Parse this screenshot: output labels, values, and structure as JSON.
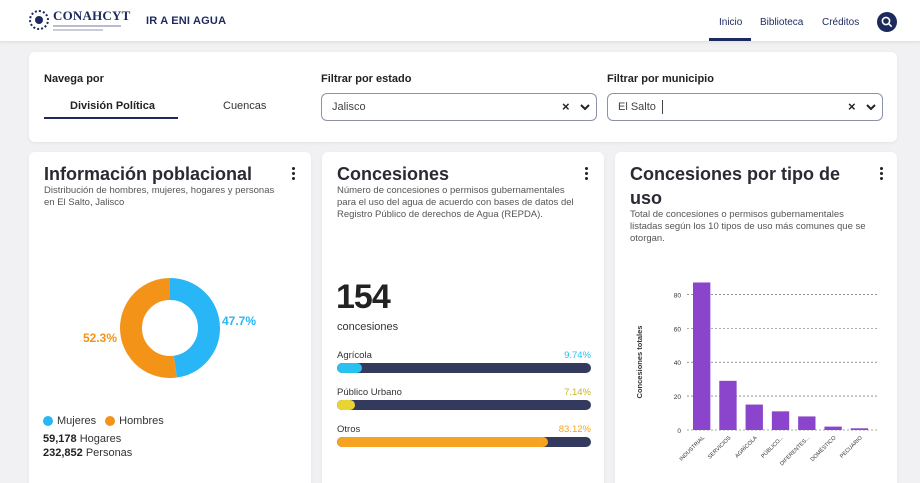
{
  "header": {
    "logo_text": "CONAHCYT",
    "ir_link": "IR A ENI AGUA",
    "nav": [
      {
        "label": "Inicio",
        "active": true
      },
      {
        "label": "Biblioteca",
        "active": false
      },
      {
        "label": "Créditos",
        "active": false
      }
    ],
    "search_icon": "search-icon"
  },
  "filters": {
    "navega_label": "Navega por",
    "tabs": [
      {
        "label": "División Política",
        "active": true
      },
      {
        "label": "Cuencas",
        "active": false
      }
    ],
    "estado_label": "Filtrar por estado",
    "estado_value": "Jalisco",
    "municipio_label": "Filtrar por municipio",
    "municipio_value": "El Salto"
  },
  "poblacion": {
    "title": "Información poblacional",
    "desc_lines": [
      "Distribución de hombres, mujeres, hogares y personas",
      "en El Salto, Jalisco"
    ],
    "donut": {
      "mujeres_pct": 47.7,
      "hombres_pct": 52.3,
      "mujeres_label": "47.7%",
      "hombres_label": "52.3%"
    },
    "legend": {
      "mujeres": "Mujeres",
      "hombres": "Hombres"
    },
    "hogares_value": "59,178",
    "hogares_label": "Hogares",
    "personas_value": "232,852",
    "personas_label": "Personas"
  },
  "concesiones": {
    "title": "Concesiones",
    "desc_lines": [
      "Número de concesiones o permisos gubernamentales",
      "para el uso del agua de acuerdo con bases de datos del",
      "Registro Público de derechos de Agua (REPDA)."
    ],
    "total": "154",
    "unit": "concesiones",
    "bars": [
      {
        "label": "Agrícola",
        "pct_text": "9.74%",
        "pct": 9.74,
        "color": "#29c1ef"
      },
      {
        "label": "Público Urbano",
        "pct_text": "7.14%",
        "pct": 7.14,
        "color": "#e8d534"
      },
      {
        "label": "Otros",
        "pct_text": "83.12%",
        "pct": 83.12,
        "color": "#f6a322"
      }
    ]
  },
  "tipo_uso": {
    "title_lines": [
      "Concesiones por tipo de",
      "uso"
    ],
    "desc_lines": [
      "Total de concesiones o permisos gubernamentales",
      "listadas según los 10 tipos de uso más comunes que se",
      "otorgan."
    ]
  },
  "colors": {
    "accent": "#1d2a5e",
    "mujeres": "#29b6f6",
    "hombres": "#f39419",
    "bar_purple": "#8b45cc",
    "track": "#343a5e"
  },
  "chart_data": {
    "type": "bar",
    "categories": [
      "INDUSTRIAL",
      "SERVICIOS",
      "AGRÍCOLA",
      "PÚBLICO...",
      "DIFERENTES...",
      "DOMÉSTICO",
      "PECUARIO"
    ],
    "values": [
      87,
      29,
      15,
      11,
      8,
      2,
      1
    ],
    "ylabel": "Concesiones totales",
    "ylim": [
      0,
      92
    ],
    "yticks": [
      0,
      20,
      40,
      60,
      80
    ],
    "grid": true
  }
}
